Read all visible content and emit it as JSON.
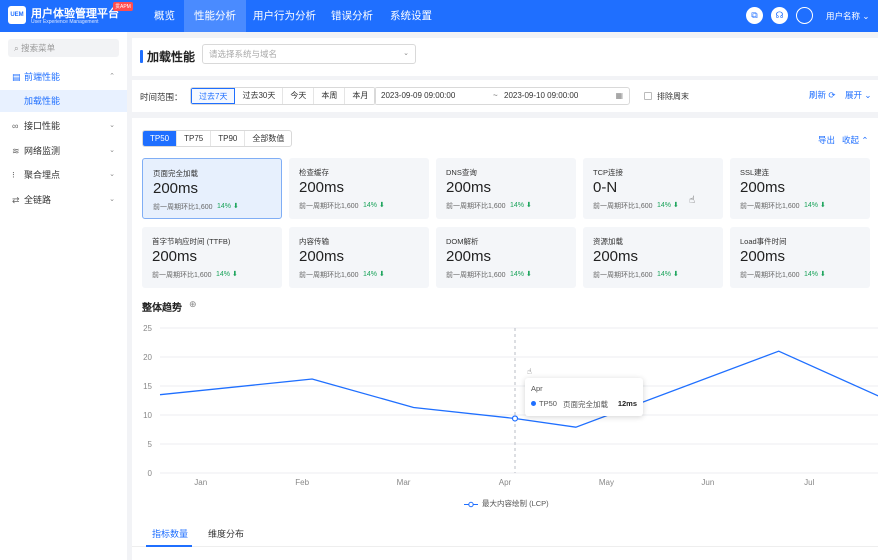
{
  "app": {
    "logo_text": "UEM",
    "title": "用户体验管理平台",
    "subtitle": "User Experience Management",
    "badge": "贯APM"
  },
  "nav": [
    "概览",
    "性能分析",
    "用户行为分析",
    "错误分析",
    "系统设置"
  ],
  "nav_active": 1,
  "header": {
    "user_name": "用户名称 ⌄",
    "icons": [
      "screenshot-icon",
      "headset-icon",
      "avatar-icon"
    ]
  },
  "sidebar": {
    "search_placeholder": "搜索菜单",
    "items": [
      {
        "label": "前端性能",
        "icon": "monitor-icon",
        "expanded": true
      },
      {
        "label": "加载性能",
        "sub": true,
        "active": true
      },
      {
        "label": "接口性能",
        "icon": "link-icon"
      },
      {
        "label": "网络监测",
        "icon": "wifi-icon"
      },
      {
        "label": "聚合埋点",
        "icon": "grid-icon"
      },
      {
        "label": "全链路",
        "icon": "trace-icon"
      }
    ]
  },
  "page": {
    "title": "加载性能",
    "system_select_placeholder": "请选择系统与域名"
  },
  "filter": {
    "label": "时间范围：",
    "ranges": [
      "过去7天",
      "过去30天",
      "今天",
      "本周",
      "本月"
    ],
    "active_range": 0,
    "start": "2023-09-09 09:00:00",
    "separator": "~",
    "end": "2023-09-10 09:00:00",
    "exclude_weekend": "排除周末",
    "exclude_weekend_checked": false,
    "refresh": "刷新 ⟳",
    "expand": "展开 ⌄"
  },
  "percentiles": {
    "options": [
      "TP50",
      "TP75",
      "TP90",
      "全部数值"
    ],
    "active": 0,
    "export": "导出",
    "collapse": "收起 ⌃"
  },
  "metrics": [
    {
      "title": "页面完全加载",
      "value": "200ms",
      "compare": "前一周期环比1,600",
      "pct": "14% ⬇",
      "active": true
    },
    {
      "title": "检查缓存",
      "value": "200ms",
      "compare": "前一周期环比1,600",
      "pct": "14% ⬇"
    },
    {
      "title": "DNS查询",
      "value": "200ms",
      "compare": "前一周期环比1,600",
      "pct": "14% ⬇"
    },
    {
      "title": "TCP连接",
      "value": "0-N",
      "compare": "前一周期环比1,600",
      "pct": "14% ⬇"
    },
    {
      "title": "SSL建连",
      "value": "200ms",
      "compare": "前一周期环比1,600",
      "pct": "14% ⬇"
    },
    {
      "title": "首字节响应时间 (TTFB)",
      "value": "200ms",
      "compare": "前一周期环比1,600",
      "pct": "14% ⬇"
    },
    {
      "title": "内容传输",
      "value": "200ms",
      "compare": "前一周期环比1,600",
      "pct": "14% ⬇"
    },
    {
      "title": "DOM解析",
      "value": "200ms",
      "compare": "前一周期环比1,600",
      "pct": "14% ⬇"
    },
    {
      "title": "资源加载",
      "value": "200ms",
      "compare": "前一周期环比1,600",
      "pct": "14% ⬇"
    },
    {
      "title": "Load事件时间",
      "value": "200ms",
      "compare": "前一周期环比1,600",
      "pct": "14% ⬇"
    }
  ],
  "trend": {
    "title": "整体趋势",
    "info_icon": "info-icon"
  },
  "chart_data": {
    "type": "line",
    "categories": [
      "Jan",
      "Feb",
      "Mar",
      "Apr",
      "May",
      "Jun",
      "Jul"
    ],
    "x": [
      0,
      1,
      2,
      3,
      4,
      5,
      6,
      7
    ],
    "yticks": [
      0,
      5,
      10,
      15,
      20,
      25
    ],
    "ylim": [
      0,
      25
    ],
    "series": [
      {
        "name": "最大内容绘制 (LCP)",
        "color": "#1f6fff",
        "points": [
          [
            0,
            13.5
          ],
          [
            1.5,
            16.2
          ],
          [
            2.5,
            11.3
          ],
          [
            3.5,
            9.4
          ],
          [
            4.1,
            7.9
          ],
          [
            6.1,
            21
          ],
          [
            7.5,
            10
          ]
        ]
      }
    ],
    "tooltip": {
      "month": "Apr",
      "series_short": "TP50",
      "series_name": "页面完全加载",
      "value": "12ms"
    },
    "grid": "horizontal"
  },
  "tabs": [
    "指标数量",
    "维度分布"
  ],
  "tab_active": 0
}
